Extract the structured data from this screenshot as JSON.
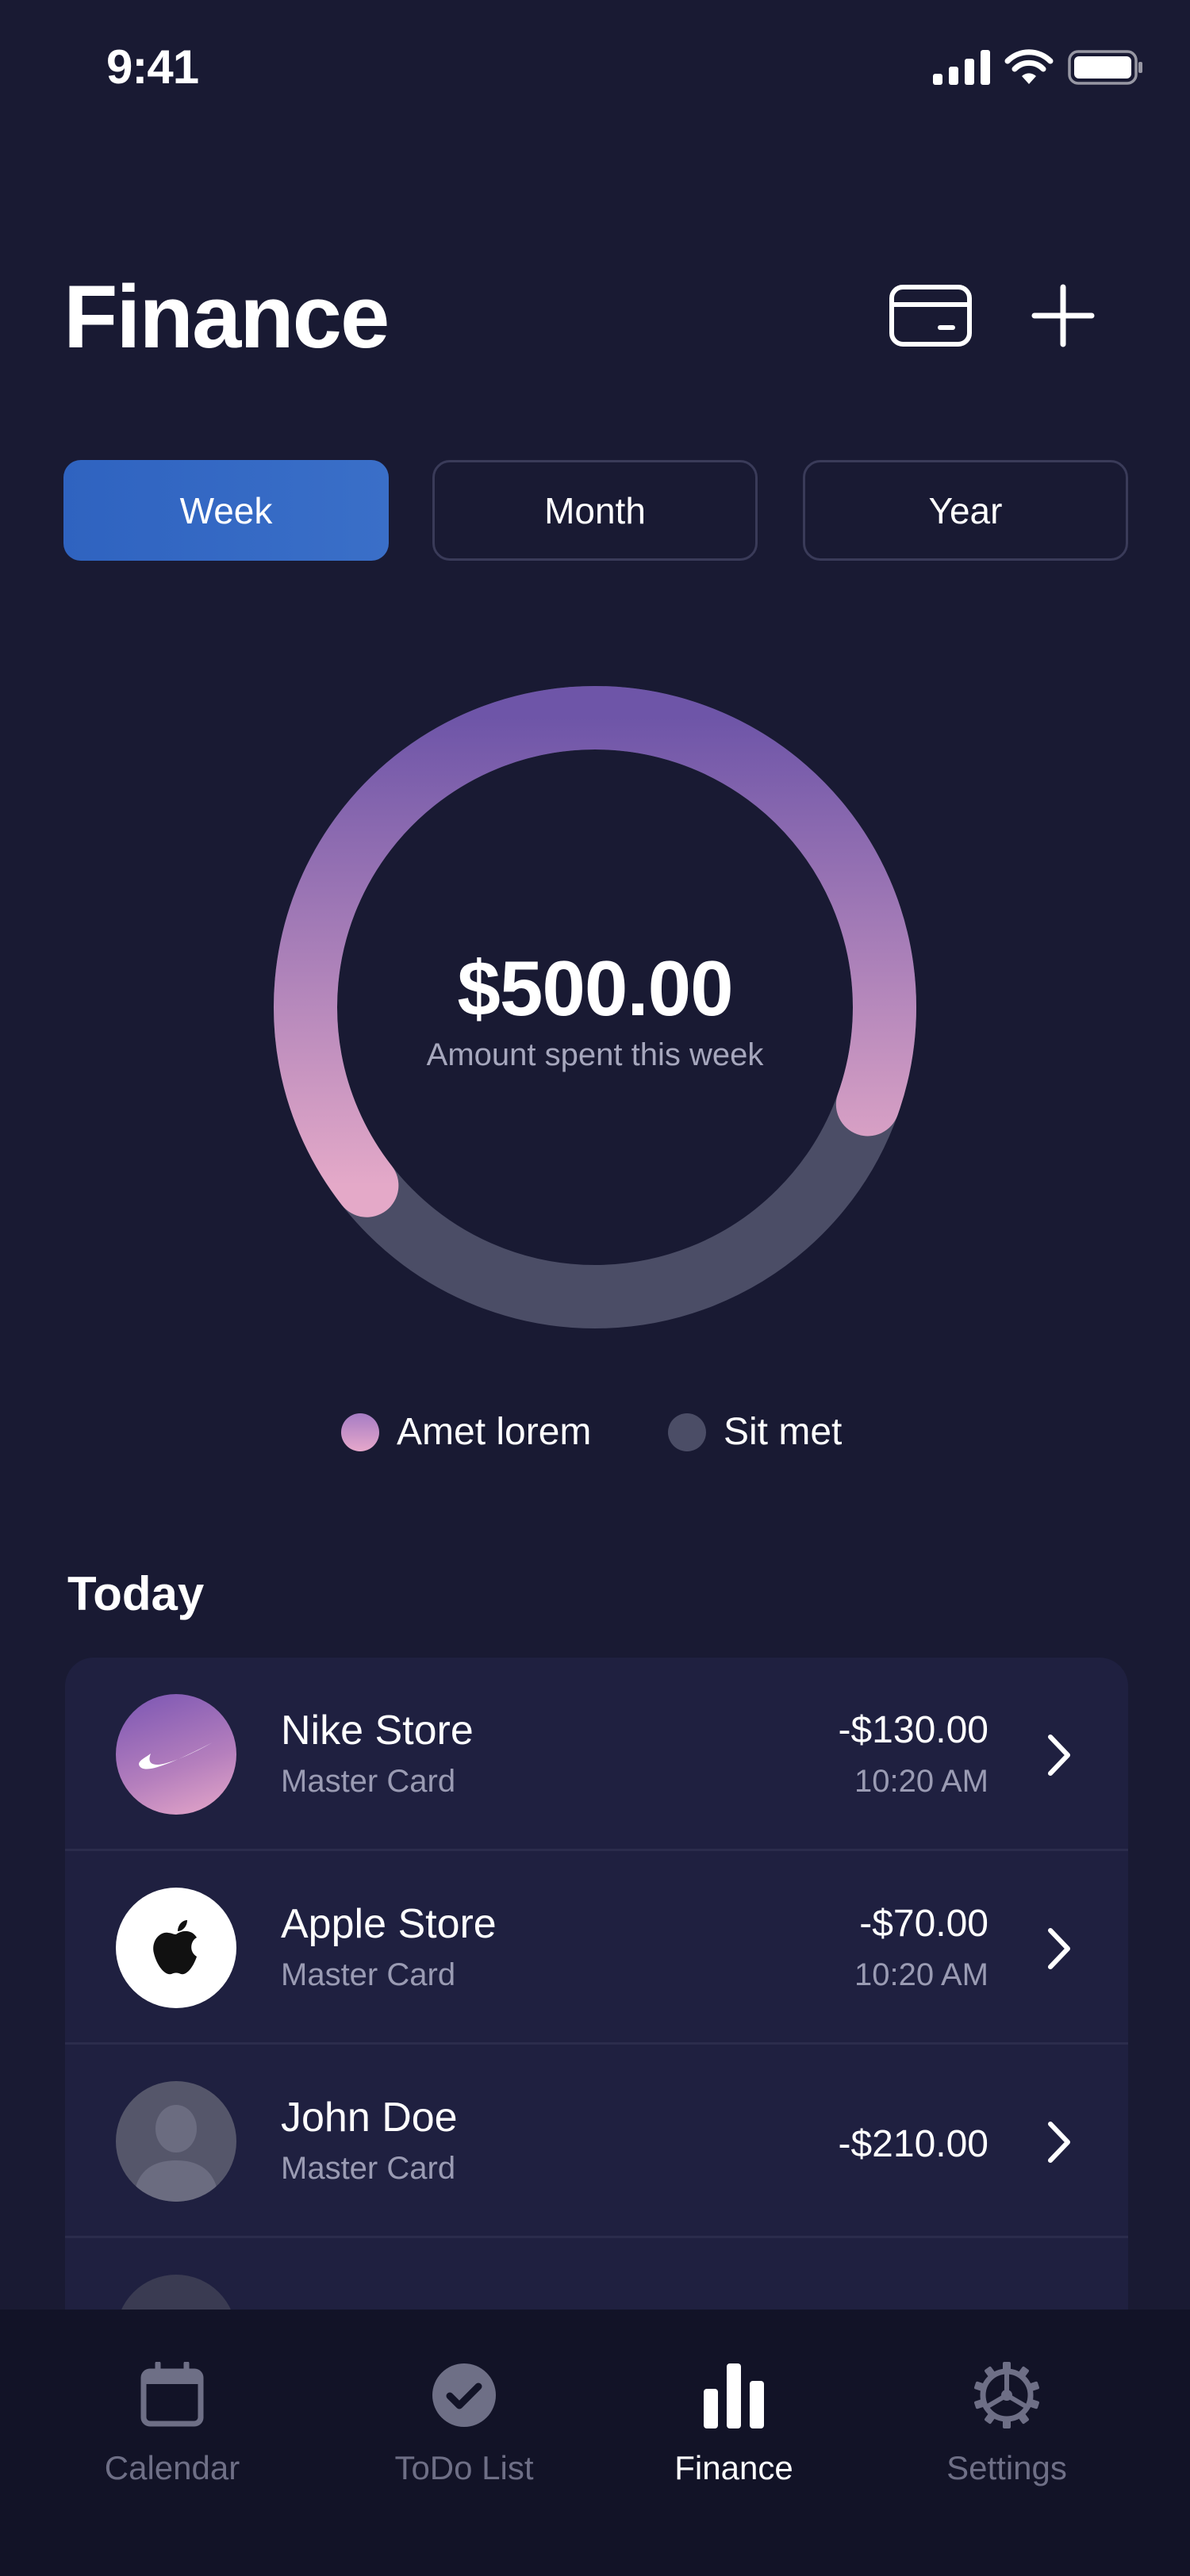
{
  "status_bar": {
    "time": "9:41"
  },
  "header": {
    "title": "Finance",
    "card_icon": "credit-card-icon",
    "add_icon": "plus-icon"
  },
  "tabs": [
    {
      "label": "Week",
      "active": true
    },
    {
      "label": "Month",
      "active": false
    },
    {
      "label": "Year",
      "active": false
    }
  ],
  "summary": {
    "amount": "$500.00",
    "caption": "Amount spent this week",
    "progress_fraction": 0.66,
    "colors": {
      "gradient_start": "#6e55a8",
      "gradient_end": "#e4a9c8",
      "remaining": "#4b4d66"
    }
  },
  "legend": [
    {
      "label": "Amet lorem",
      "color": "#c895c9"
    },
    {
      "label": "Sit met",
      "color": "#4b4d66"
    }
  ],
  "today": {
    "title": "Today",
    "transactions": [
      {
        "name": "Nike Store",
        "method": "Master Card",
        "amount": "-$130.00",
        "time": "10:20 AM",
        "icon": "nike-logo-icon"
      },
      {
        "name": "Apple Store",
        "method": "Master Card",
        "amount": "-$70.00",
        "time": "10:20 AM",
        "icon": "apple-logo-icon"
      },
      {
        "name": "John Doe",
        "method": "Master Card",
        "amount": "-$210.00",
        "icon": "person-icon"
      }
    ]
  },
  "tab_bar": [
    {
      "label": "Calendar",
      "icon": "calendar-icon",
      "active": false
    },
    {
      "label": "ToDo List",
      "icon": "check-circle-icon",
      "active": false
    },
    {
      "label": "Finance",
      "icon": "bar-chart-icon",
      "active": true
    },
    {
      "label": "Settings",
      "icon": "gear-icon",
      "active": false
    }
  ]
}
